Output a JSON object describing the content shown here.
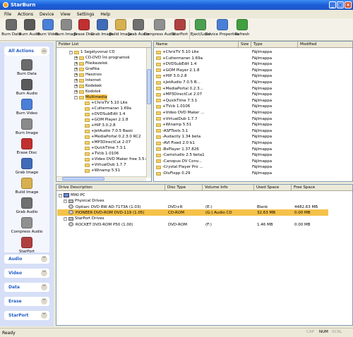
{
  "window": {
    "title": "StarBurn"
  },
  "menu": [
    "File",
    "Actions",
    "Device",
    "View",
    "Settings",
    "Help"
  ],
  "toolbar": [
    {
      "label": "Burn Data",
      "icon": "burn-data-icon",
      "color": "#6b6b6b"
    },
    {
      "label": "Burn Audio",
      "icon": "burn-audio-icon",
      "color": "#5a5a5a"
    },
    {
      "label": "Burn Video",
      "icon": "burn-video-icon",
      "color": "#4a7fd8"
    },
    {
      "label": "Burn Image",
      "icon": "burn-image-icon",
      "color": "#8a8a8a"
    },
    {
      "label": "Erase Disc",
      "icon": "erase-disc-icon",
      "color": "#c03030"
    },
    {
      "label": "Grab Image",
      "icon": "grab-image-icon",
      "color": "#3f6cb8"
    },
    {
      "label": "Build Image",
      "icon": "build-image-icon",
      "color": "#d8b050"
    },
    {
      "label": "Grab Audio",
      "icon": "grab-audio-icon",
      "color": "#707070"
    },
    {
      "label": "Compress Audio",
      "icon": "compress-audio-icon",
      "color": "#909090"
    },
    {
      "label": "StarPort",
      "icon": "starport-icon",
      "color": "#b04040"
    },
    {
      "label": "Eject/Load",
      "icon": "eject-load-icon",
      "color": "#4aa050"
    },
    {
      "label": "Device Properties",
      "icon": "device-properties-icon",
      "color": "#4a7fd8"
    },
    {
      "label": "Refresh",
      "icon": "refresh-icon",
      "color": "#40a040"
    }
  ],
  "sidebar": {
    "all_actions": "All Actions",
    "actions": [
      {
        "label": "Burn Data",
        "icon": "burn-data-icon",
        "color": "#6b6b6b"
      },
      {
        "label": "Burn Audio",
        "icon": "burn-audio-icon",
        "color": "#5a5a5a"
      },
      {
        "label": "Burn Video",
        "icon": "burn-video-icon",
        "color": "#4a7fd8"
      },
      {
        "label": "Burn Image",
        "icon": "burn-image-icon",
        "color": "#8a8a8a"
      },
      {
        "label": "Erase Disc",
        "icon": "erase-disc-icon",
        "color": "#c03030"
      },
      {
        "label": "Grab Image",
        "icon": "grab-image-icon",
        "color": "#3f6cb8"
      },
      {
        "label": "Build Image",
        "icon": "build-image-icon",
        "color": "#d8b050"
      },
      {
        "label": "Grab Audio",
        "icon": "grab-audio-icon",
        "color": "#707070"
      },
      {
        "label": "Compress Audio",
        "icon": "compress-audio-icon",
        "color": "#909090"
      },
      {
        "label": "StarPort",
        "icon": "starport-icon",
        "color": "#b04040"
      }
    ],
    "sections": [
      "Audio",
      "Video",
      "Data",
      "Erase",
      "StarPort"
    ]
  },
  "folder_list": {
    "header": "Folder List",
    "root": "1 Segélyvonal CD",
    "items": [
      "CD-DVD Író programok",
      "Fileikezelok",
      "Grafika",
      "Hasznos",
      "Internet",
      "Kodekek",
      "Kodolok",
      "Multimedia"
    ],
    "selected": "Multimedia",
    "subitems": [
      "+ChrisTV 5.10 Lite",
      "+Cuttermaran 1.69a",
      "+DVDSubEdit 1.4",
      "+GOM Player 2.1.8",
      "+HIP 3.0.2.8",
      "+JetAudio 7.0.5 Basic",
      "+MediaPortal 0.2.3.0 RC2",
      "+MP3DirectCut 2.07",
      "+QuickTime 7.3.1",
      "+TVcb 1.0106",
      "+Video DVD Maker free 3.5.0",
      "+VirtualDub 1.7.7",
      "+Winamp 5.51"
    ]
  },
  "file_list": {
    "columns": [
      "Name",
      "Size",
      "Type",
      "Modified"
    ],
    "names": [
      "+ChrisTV 5.10 Lite",
      "+Cuttermaran 1.69a",
      "+DVDSubEdit 1.4",
      "+GOM Player 2.1.8",
      "+HIP 3.0.2.8",
      "+JetAudio 7.0.5 B...",
      "+MediaPortal 0.2.3...",
      "+MP3DirectCut 2.07",
      "+QuickTime 7.3.1",
      "+TVcb 1.0106",
      "+Video DVD Maker ...",
      "+VirtualDub 1.7.7",
      "+Winamp 5.51",
      "-ASFTools 3.1",
      "-Audacity 1.34 beta",
      "-AVI Fixed 2.0 b1",
      "-BsPlayer 1.37.826",
      "-Camstudio 2.5 beta1",
      "-Canopus DV Conv...",
      "-Crystal Player Pro ...",
      "-DivFixpp 0.29"
    ],
    "type": "Fájlmappa"
  },
  "drives": {
    "columns": [
      "Drive Description",
      "Disc Type",
      "Volume Info",
      "Used Space",
      "Free Space"
    ],
    "pc": "MIKI-PC",
    "physical": "Physical Drives",
    "rows": [
      {
        "desc": "Optiarc  DVD RW AD-7173A (1.03)",
        "disc": "DVD+R",
        "volume": "(E:)",
        "used": "Blank",
        "free": "4482.63 MB"
      },
      {
        "desc": "PIONEER  DVD-ROM DVD-119 (1.05)",
        "disc": "CD-ROM",
        "volume": "(G:) Audio CD",
        "used": "32.63 MB",
        "free": "0.00 MB"
      }
    ],
    "starport": "StarPort Drives",
    "starport_rows": [
      {
        "desc": "ROCKET  DVD-ROM P50 (1.00)",
        "disc": "DVD-ROM",
        "volume": "(F:)",
        "used": "1.46 MB",
        "free": "0.00 MB"
      }
    ]
  },
  "status": {
    "text": "Ready",
    "caps": "CAP",
    "num": "NUM",
    "scrl": "SCRL"
  }
}
